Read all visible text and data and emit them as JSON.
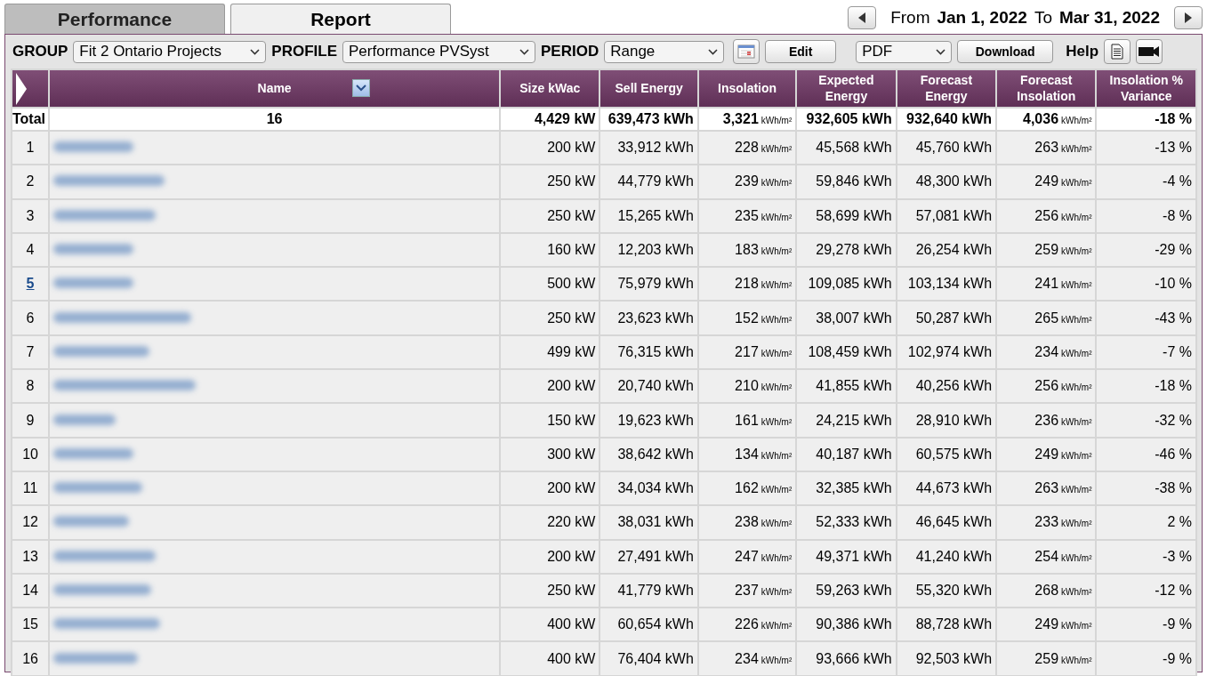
{
  "tabs": [
    {
      "label": "Performance",
      "selected": false
    },
    {
      "label": "Report",
      "selected": true
    }
  ],
  "date_range": {
    "from_label": "From",
    "from": "Jan 1, 2022",
    "to_label": "To",
    "to": "Mar 31, 2022"
  },
  "toolbar": {
    "group_label": "GROUP",
    "group": "Fit 2 Ontario Projects",
    "profile_label": "PROFILE",
    "profile": "Performance PVSyst",
    "period_label": "PERIOD",
    "period": "Range",
    "edit": "Edit",
    "format": "PDF",
    "download": "Download",
    "help": "Help"
  },
  "table": {
    "columns": [
      "Name",
      "Size kWac",
      "Sell Energy",
      "Insolation",
      "Expected Energy",
      "Forecast Energy",
      "Forecast Insolation",
      "Insolation % Variance"
    ],
    "total": {
      "label": "Total",
      "count": "16",
      "size": "4,429 kW",
      "sell": "639,473 kWh",
      "insolation": "3,321",
      "insolation_unit": "kWh/m²",
      "expected": "932,605 kWh",
      "forecast": "932,640 kWh",
      "forecast_insolation": "4,036",
      "forecast_insolation_unit": "kWh/m²",
      "variance": "-18 %"
    },
    "rows": [
      {
        "no": "1",
        "link": false,
        "size": "200 kW",
        "sell": "33,912 kWh",
        "insolation": "228",
        "insolation_unit": "kWh/m²",
        "expected": "45,568 kWh",
        "forecast": "45,760 kWh",
        "forecast_insolation": "263",
        "forecast_insolation_unit": "kWh/m²",
        "variance": "-13 %"
      },
      {
        "no": "2",
        "link": false,
        "size": "250 kW",
        "sell": "44,779 kWh",
        "insolation": "239",
        "insolation_unit": "kWh/m²",
        "expected": "59,846 kWh",
        "forecast": "48,300 kWh",
        "forecast_insolation": "249",
        "forecast_insolation_unit": "kWh/m²",
        "variance": "-4 %"
      },
      {
        "no": "3",
        "link": false,
        "size": "250 kW",
        "sell": "15,265 kWh",
        "insolation": "235",
        "insolation_unit": "kWh/m²",
        "expected": "58,699 kWh",
        "forecast": "57,081 kWh",
        "forecast_insolation": "256",
        "forecast_insolation_unit": "kWh/m²",
        "variance": "-8 %"
      },
      {
        "no": "4",
        "link": false,
        "size": "160 kW",
        "sell": "12,203 kWh",
        "insolation": "183",
        "insolation_unit": "kWh/m²",
        "expected": "29,278 kWh",
        "forecast": "26,254 kWh",
        "forecast_insolation": "259",
        "forecast_insolation_unit": "kWh/m²",
        "variance": "-29 %"
      },
      {
        "no": "5",
        "link": true,
        "size": "500 kW",
        "sell": "75,979 kWh",
        "insolation": "218",
        "insolation_unit": "kWh/m²",
        "expected": "109,085 kWh",
        "forecast": "103,134 kWh",
        "forecast_insolation": "241",
        "forecast_insolation_unit": "kWh/m²",
        "variance": "-10 %"
      },
      {
        "no": "6",
        "link": false,
        "size": "250 kW",
        "sell": "23,623 kWh",
        "insolation": "152",
        "insolation_unit": "kWh/m²",
        "expected": "38,007 kWh",
        "forecast": "50,287 kWh",
        "forecast_insolation": "265",
        "forecast_insolation_unit": "kWh/m²",
        "variance": "-43 %"
      },
      {
        "no": "7",
        "link": false,
        "size": "499 kW",
        "sell": "76,315 kWh",
        "insolation": "217",
        "insolation_unit": "kWh/m²",
        "expected": "108,459 kWh",
        "forecast": "102,974 kWh",
        "forecast_insolation": "234",
        "forecast_insolation_unit": "kWh/m²",
        "variance": "-7 %"
      },
      {
        "no": "8",
        "link": false,
        "size": "200 kW",
        "sell": "20,740 kWh",
        "insolation": "210",
        "insolation_unit": "kWh/m²",
        "expected": "41,855 kWh",
        "forecast": "40,256 kWh",
        "forecast_insolation": "256",
        "forecast_insolation_unit": "kWh/m²",
        "variance": "-18 %"
      },
      {
        "no": "9",
        "link": false,
        "size": "150 kW",
        "sell": "19,623 kWh",
        "insolation": "161",
        "insolation_unit": "kWh/m²",
        "expected": "24,215 kWh",
        "forecast": "28,910 kWh",
        "forecast_insolation": "236",
        "forecast_insolation_unit": "kWh/m²",
        "variance": "-32 %"
      },
      {
        "no": "10",
        "link": false,
        "size": "300 kW",
        "sell": "38,642 kWh",
        "insolation": "134",
        "insolation_unit": "kWh/m²",
        "expected": "40,187 kWh",
        "forecast": "60,575 kWh",
        "forecast_insolation": "249",
        "forecast_insolation_unit": "kWh/m²",
        "variance": "-46 %"
      },
      {
        "no": "11",
        "link": false,
        "size": "200 kW",
        "sell": "34,034 kWh",
        "insolation": "162",
        "insolation_unit": "kWh/m²",
        "expected": "32,385 kWh",
        "forecast": "44,673 kWh",
        "forecast_insolation": "263",
        "forecast_insolation_unit": "kWh/m²",
        "variance": "-38 %"
      },
      {
        "no": "12",
        "link": false,
        "size": "220 kW",
        "sell": "38,031 kWh",
        "insolation": "238",
        "insolation_unit": "kWh/m²",
        "expected": "52,333 kWh",
        "forecast": "46,645 kWh",
        "forecast_insolation": "233",
        "forecast_insolation_unit": "kWh/m²",
        "variance": "2 %"
      },
      {
        "no": "13",
        "link": false,
        "size": "200 kW",
        "sell": "27,491 kWh",
        "insolation": "247",
        "insolation_unit": "kWh/m²",
        "expected": "49,371 kWh",
        "forecast": "41,240 kWh",
        "forecast_insolation": "254",
        "forecast_insolation_unit": "kWh/m²",
        "variance": "-3 %"
      },
      {
        "no": "14",
        "link": false,
        "size": "250 kW",
        "sell": "41,779 kWh",
        "insolation": "237",
        "insolation_unit": "kWh/m²",
        "expected": "59,263 kWh",
        "forecast": "55,320 kWh",
        "forecast_insolation": "268",
        "forecast_insolation_unit": "kWh/m²",
        "variance": "-12 %"
      },
      {
        "no": "15",
        "link": false,
        "size": "400 kW",
        "sell": "60,654 kWh",
        "insolation": "226",
        "insolation_unit": "kWh/m²",
        "expected": "90,386 kWh",
        "forecast": "88,728 kWh",
        "forecast_insolation": "249",
        "forecast_insolation_unit": "kWh/m²",
        "variance": "-9 %"
      },
      {
        "no": "16",
        "link": false,
        "size": "400 kW",
        "sell": "76,404 kWh",
        "insolation": "234",
        "insolation_unit": "kWh/m²",
        "expected": "93,666 kWh",
        "forecast": "92,503 kWh",
        "forecast_insolation": "259",
        "forecast_insolation_unit": "kWh/m²",
        "variance": "-9 %"
      }
    ]
  }
}
